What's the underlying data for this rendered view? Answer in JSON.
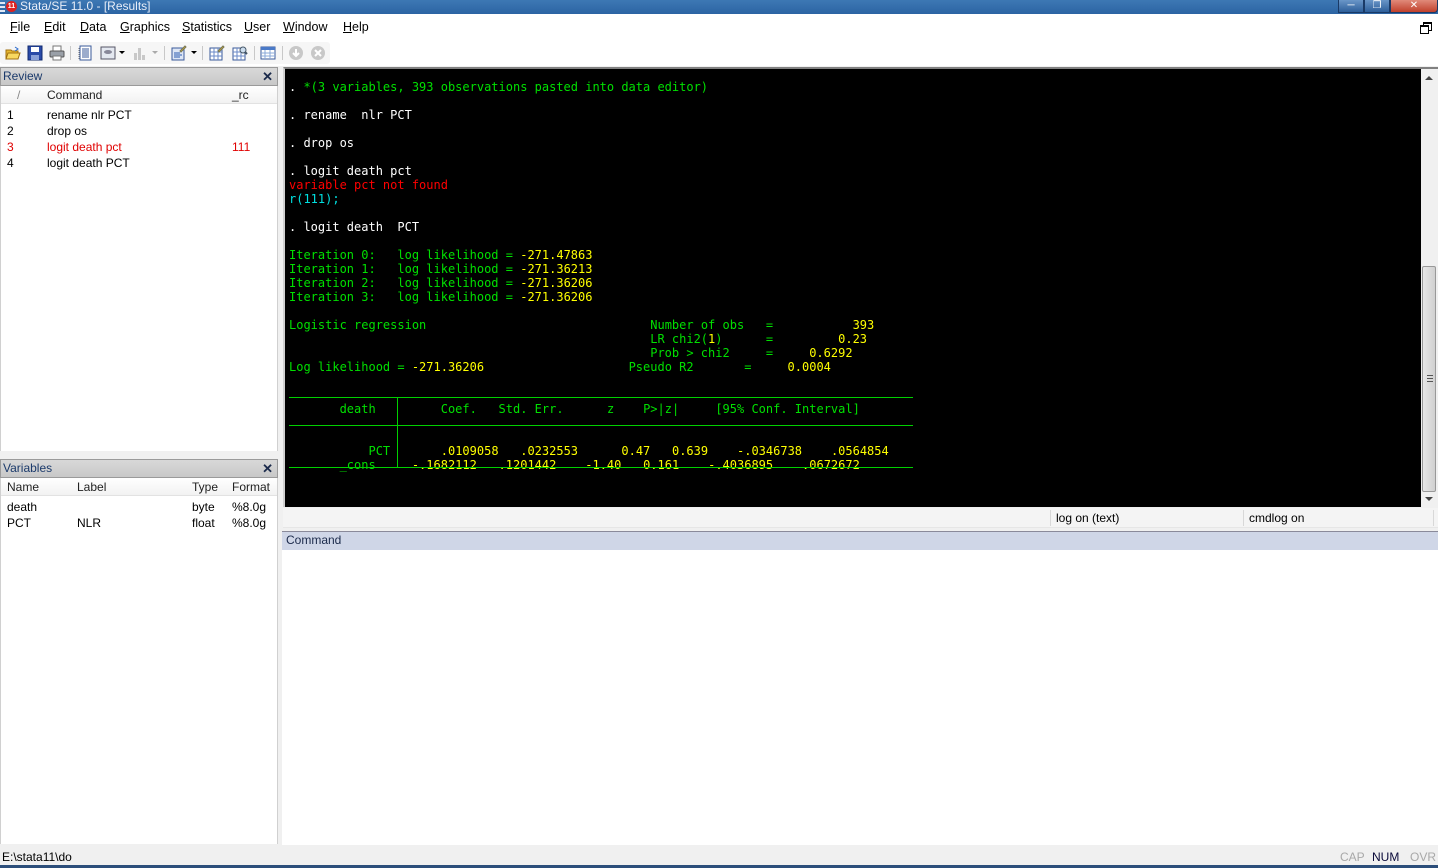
{
  "window": {
    "title": "Stata/SE 11.0 - [Results]",
    "app_badge": "11",
    "controls": [
      "minimize",
      "maximize",
      "close"
    ]
  },
  "menubar": {
    "items": [
      {
        "label": "File",
        "mnemonic": "F"
      },
      {
        "label": "Edit",
        "mnemonic": "E"
      },
      {
        "label": "Data",
        "mnemonic": "D"
      },
      {
        "label": "Graphics",
        "mnemonic": "G"
      },
      {
        "label": "Statistics",
        "mnemonic": "S"
      },
      {
        "label": "User",
        "mnemonic": "U"
      },
      {
        "label": "Window",
        "mnemonic": "W"
      },
      {
        "label": "Help",
        "mnemonic": "H"
      }
    ]
  },
  "toolbar": {
    "buttons": [
      {
        "name": "open-icon",
        "enabled": true
      },
      {
        "name": "save-icon",
        "enabled": true
      },
      {
        "name": "print-icon",
        "enabled": true
      },
      {
        "name": "log-icon",
        "enabled": true
      },
      {
        "name": "viewer-icon",
        "enabled": true,
        "dropdown": true
      },
      {
        "name": "graph-icon",
        "enabled": false,
        "dropdown": true
      },
      {
        "name": "do-file-editor-icon",
        "enabled": true,
        "dropdown": true
      },
      {
        "name": "data-editor-icon",
        "enabled": true
      },
      {
        "name": "data-browser-icon",
        "enabled": true
      },
      {
        "name": "variables-manager-icon",
        "enabled": true
      },
      {
        "name": "more-icon",
        "enabled": false
      },
      {
        "name": "break-icon",
        "enabled": false
      }
    ]
  },
  "review": {
    "title": "Review",
    "columns": [
      "/",
      "Command",
      "_rc"
    ],
    "rows": [
      {
        "num": "1",
        "command": "rename  nlr PCT",
        "rc": "",
        "error": false
      },
      {
        "num": "2",
        "command": "drop os",
        "rc": "",
        "error": false
      },
      {
        "num": "3",
        "command": "logit death pct",
        "rc": "111",
        "error": true
      },
      {
        "num": "4",
        "command": "logit death  PCT",
        "rc": "",
        "error": false
      }
    ]
  },
  "variables": {
    "title": "Variables",
    "columns": [
      "Name",
      "Label",
      "Type",
      "Format"
    ],
    "rows": [
      {
        "name": "death",
        "label": "",
        "type": "byte",
        "format": "%8.0g"
      },
      {
        "name": "PCT",
        "label": "NLR",
        "type": "float",
        "format": "%8.0g"
      }
    ]
  },
  "results": {
    "paste_note": "*(3 variables, 393 observations pasted into data editor)",
    "cmd1": "rename  nlr PCT",
    "cmd2": "drop os",
    "cmd3": "logit death pct",
    "err_msg": "variable pct not found",
    "err_code": "r(111);",
    "cmd4": "logit death  PCT",
    "iterations": [
      {
        "label": "Iteration 0:",
        "text": "log likelihood =",
        "value": "-271.47863"
      },
      {
        "label": "Iteration 1:",
        "text": "log likelihood =",
        "value": "-271.36213"
      },
      {
        "label": "Iteration 2:",
        "text": "log likelihood =",
        "value": "-271.36206"
      },
      {
        "label": "Iteration 3:",
        "text": "log likelihood =",
        "value": "-271.36206"
      }
    ],
    "model_title": "Logistic regression",
    "loglik_label": "Log likelihood =",
    "loglik_value": "-271.36206",
    "stats": [
      {
        "label": "Number of obs",
        "eq": "=",
        "value": "393"
      },
      {
        "label": "LR chi2(",
        "df": "1",
        "label_end": ")",
        "eq": "=",
        "value": "0.23"
      },
      {
        "label": "Prob > chi2",
        "eq": "=",
        "value": "0.6292"
      },
      {
        "label": "Pseudo R2",
        "eq": "=",
        "value": "0.0004"
      }
    ],
    "table": {
      "depvar": "death",
      "headers": [
        "Coef.",
        "Std. Err.",
        "z",
        "P>|z|",
        "[95% Conf. Interval]"
      ],
      "rows": [
        {
          "var": "PCT",
          "coef": ".0109058",
          "se": ".0232553",
          "z": "0.47",
          "p": "0.639",
          "ci_lo": "-.0346738",
          "ci_hi": ".0564854"
        },
        {
          "var": "_cons",
          "coef": "-.1682112",
          "se": ".1201442",
          "z": "-1.40",
          "p": "0.161",
          "ci_lo": "-.4036895",
          "ci_hi": ".0672672"
        }
      ]
    },
    "prompt": "."
  },
  "log_status": {
    "log": "log on (text)",
    "cmdlog": "cmdlog on"
  },
  "command": {
    "title": "Command",
    "value": ""
  },
  "statusbar": {
    "path": "E:\\stata11\\do",
    "indicators": [
      {
        "label": "CAP",
        "active": false
      },
      {
        "label": "NUM",
        "active": true
      },
      {
        "label": "OVR",
        "active": false
      }
    ]
  }
}
